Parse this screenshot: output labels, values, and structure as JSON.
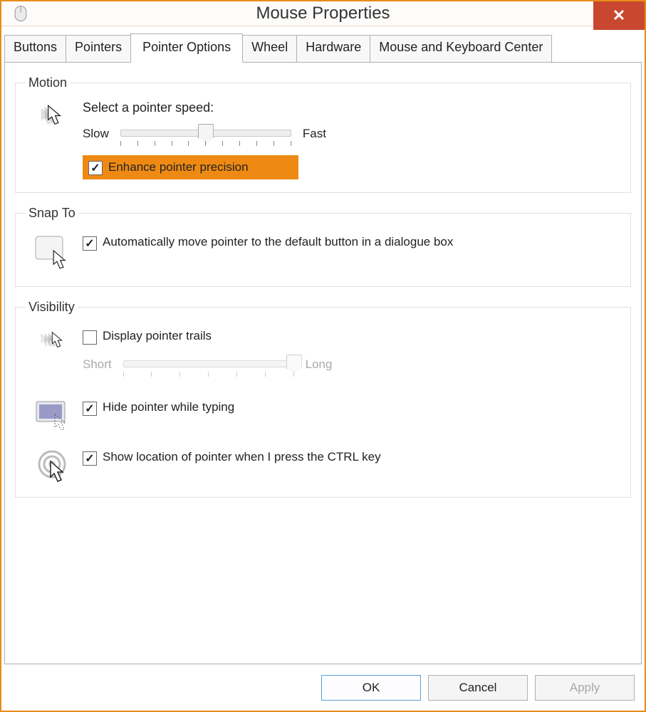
{
  "window": {
    "title": "Mouse Properties",
    "close_glyph": "✕"
  },
  "tabs": [
    "Buttons",
    "Pointers",
    "Pointer Options",
    "Wheel",
    "Hardware",
    "Mouse and Keyboard Center"
  ],
  "active_tab": "Pointer Options",
  "motion": {
    "legend": "Motion",
    "label": "Select a pointer speed:",
    "slow": "Slow",
    "fast": "Fast",
    "slider": {
      "min": 0,
      "max": 10,
      "value": 5
    },
    "enhance_label": "Enhance pointer precision",
    "enhance_checked": true
  },
  "snap": {
    "legend": "Snap To",
    "label": "Automatically move pointer to the default button in a dialogue box",
    "checked": true
  },
  "visibility": {
    "legend": "Visibility",
    "trails_label": "Display pointer trails",
    "trails_checked": false,
    "short": "Short",
    "long": "Long",
    "trail_slider": {
      "min": 0,
      "max": 6,
      "value": 6,
      "disabled": true
    },
    "hide_label": "Hide pointer while typing",
    "hide_checked": true,
    "ctrl_label": "Show location of pointer when I press the CTRL key",
    "ctrl_checked": true
  },
  "buttons": {
    "ok": "OK",
    "cancel": "Cancel",
    "apply": "Apply"
  }
}
